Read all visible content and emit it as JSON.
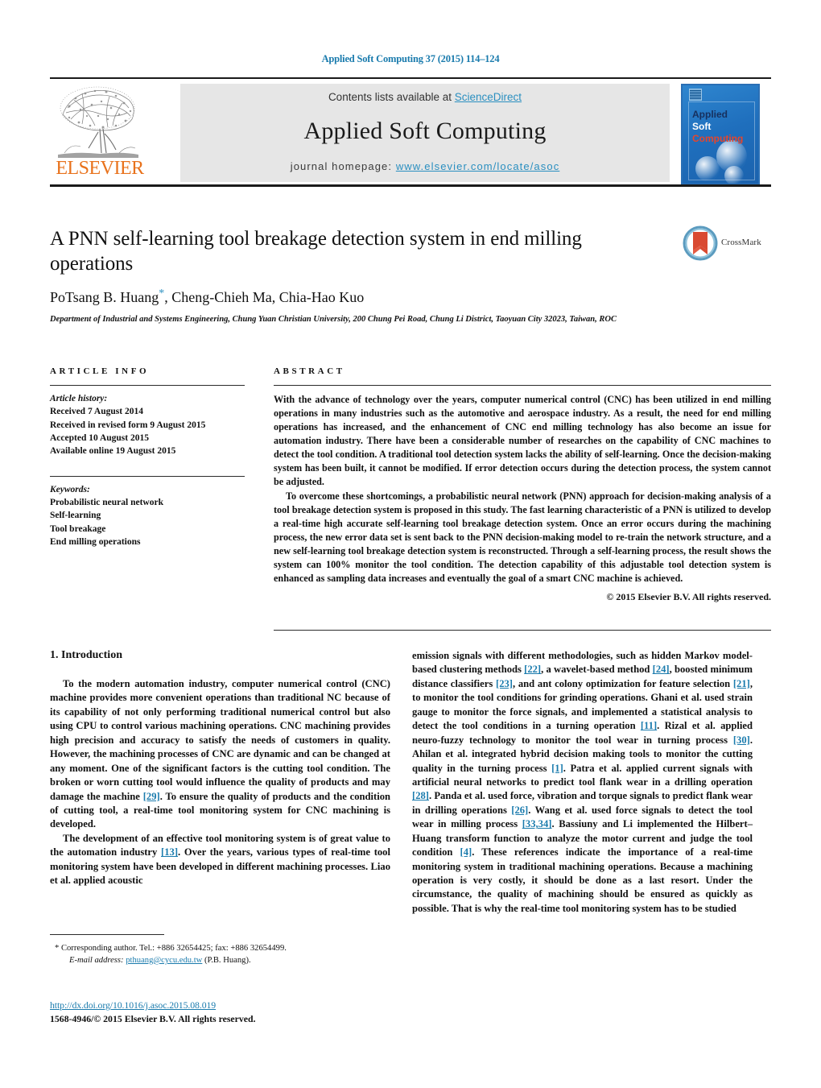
{
  "running_head": "Applied Soft Computing 37 (2015) 114–124",
  "masthead": {
    "contents_prefix": "Contents lists available at ",
    "contents_link": "ScienceDirect",
    "journal_title": "Applied Soft Computing",
    "homepage_prefix": "journal homepage: ",
    "homepage_url": "www.elsevier.com/locate/asoc",
    "publisher_logo_text": "ELSEVIER",
    "cover": {
      "line1": "Applied",
      "line2": "Soft",
      "line3": "Computing"
    },
    "colors": {
      "link": "#2a8fc0",
      "band": "#e6e6e6",
      "elsevier_orange": "#e8721c",
      "cover_blue": "#1f6fbd"
    }
  },
  "crossmark": {
    "label": "CrossMark"
  },
  "article": {
    "title": "A PNN self-learning tool breakage detection system in end milling operations",
    "authors": "PoTsang B. Huang",
    "author_marker": "*",
    "authors_rest": ", Cheng-Chieh Ma, Chia-Hao Kuo",
    "affiliation": "Department of Industrial and Systems Engineering, Chung Yuan Christian University, 200 Chung Pei Road, Chung Li District, Taoyuan City 32023, Taiwan, ROC"
  },
  "article_info": {
    "heading": "ARTICLE INFO",
    "history_label": "Article history:",
    "history": [
      "Received 7 August 2014",
      "Received in revised form 9 August 2015",
      "Accepted 10 August 2015",
      "Available online 19 August 2015"
    ],
    "keywords_label": "Keywords:",
    "keywords": [
      "Probabilistic neural network",
      "Self-learning",
      "Tool breakage",
      "End milling operations"
    ]
  },
  "abstract": {
    "heading": "ABSTRACT",
    "paragraph1": "With the advance of technology over the years, computer numerical control (CNC) has been utilized in end milling operations in many industries such as the automotive and aerospace industry. As a result, the need for end milling operations has increased, and the enhancement of CNC end milling technology has also become an issue for automation industry. There have been a considerable number of researches on the capability of CNC machines to detect the tool condition. A traditional tool detection system lacks the ability of self-learning. Once the decision-making system has been built, it cannot be modified. If error detection occurs during the detection process, the system cannot be adjusted.",
    "paragraph2": "To overcome these shortcomings, a probabilistic neural network (PNN) approach for decision-making analysis of a tool breakage detection system is proposed in this study. The fast learning characteristic of a PNN is utilized to develop a real-time high accurate self-learning tool breakage detection system. Once an error occurs during the machining process, the new error data set is sent back to the PNN decision-making model to re-train the network structure, and a new self-learning tool breakage detection system is reconstructed. Through a self-learning process, the result shows the system can 100% monitor the tool condition. The detection capability of this adjustable tool detection system is enhanced as sampling data increases and eventually the goal of a smart CNC machine is achieved.",
    "copyright": "© 2015 Elsevier B.V. All rights reserved."
  },
  "introduction": {
    "heading": "1.  Introduction",
    "left_p1": "To the modern automation industry, computer numerical control (CNC) machine provides more convenient operations than traditional NC because of its capability of not only performing traditional numerical control but also using CPU to control various machining operations. CNC machining provides high precision and accuracy to satisfy the needs of customers in quality. However, the machining processes of CNC are dynamic and can be changed at any moment. One of the significant factors is the cutting tool condition. The broken or worn cutting tool would influence the quality of products and may damage the machine [29]. To ensure the quality of products and the condition of cutting tool, a real-time tool monitoring system for CNC machining is developed.",
    "left_p2": "The development of an effective tool monitoring system is of great value to the automation industry [13]. Over the years, various types of real-time tool monitoring system have been developed in different machining processes. Liao et al. applied acoustic",
    "right_p1": "emission signals with different methodologies, such as hidden Markov model-based clustering methods [22], a wavelet-based method [24], boosted minimum distance classifiers [23], and ant colony optimization for feature selection [21], to monitor the tool conditions for grinding operations. Ghani et al. used strain gauge to monitor the force signals, and implemented a statistical analysis to detect the tool conditions in a turning operation [11]. Rizal et al. applied neuro-fuzzy technology to monitor the tool wear in turning process [30]. Ahilan et al. integrated hybrid decision making tools to monitor the cutting quality in the turning process [1]. Patra et al. applied current signals with artificial neural networks to predict tool flank wear in a drilling operation [28]. Panda et al. used force, vibration and torque signals to predict flank wear in drilling operations [26]. Wang et al. used force signals to detect the tool wear in milling process [33,34]. Bassiuny and Li implemented the Hilbert–Huang transform function to analyze the motor current and judge the tool condition [4]. These references indicate the importance of a real-time monitoring system in traditional machining operations. Because a machining operation is very costly, it should be done as a last resort. Under the circumstance, the quality of machining should be ensured as quickly as possible. That is why the real-time tool monitoring system has to be studied"
  },
  "footnote": {
    "line1": "*  Corresponding author. Tel.: +886 32654425; fax: +886 32654499.",
    "email_label": "E-mail address:",
    "email": "pthuang@cycu.edu.tw",
    "email_suffix": " (P.B. Huang)."
  },
  "footer": {
    "doi": "http://dx.doi.org/10.1016/j.asoc.2015.08.019",
    "issn_line": "1568-4946/© 2015 Elsevier B.V. All rights reserved."
  }
}
